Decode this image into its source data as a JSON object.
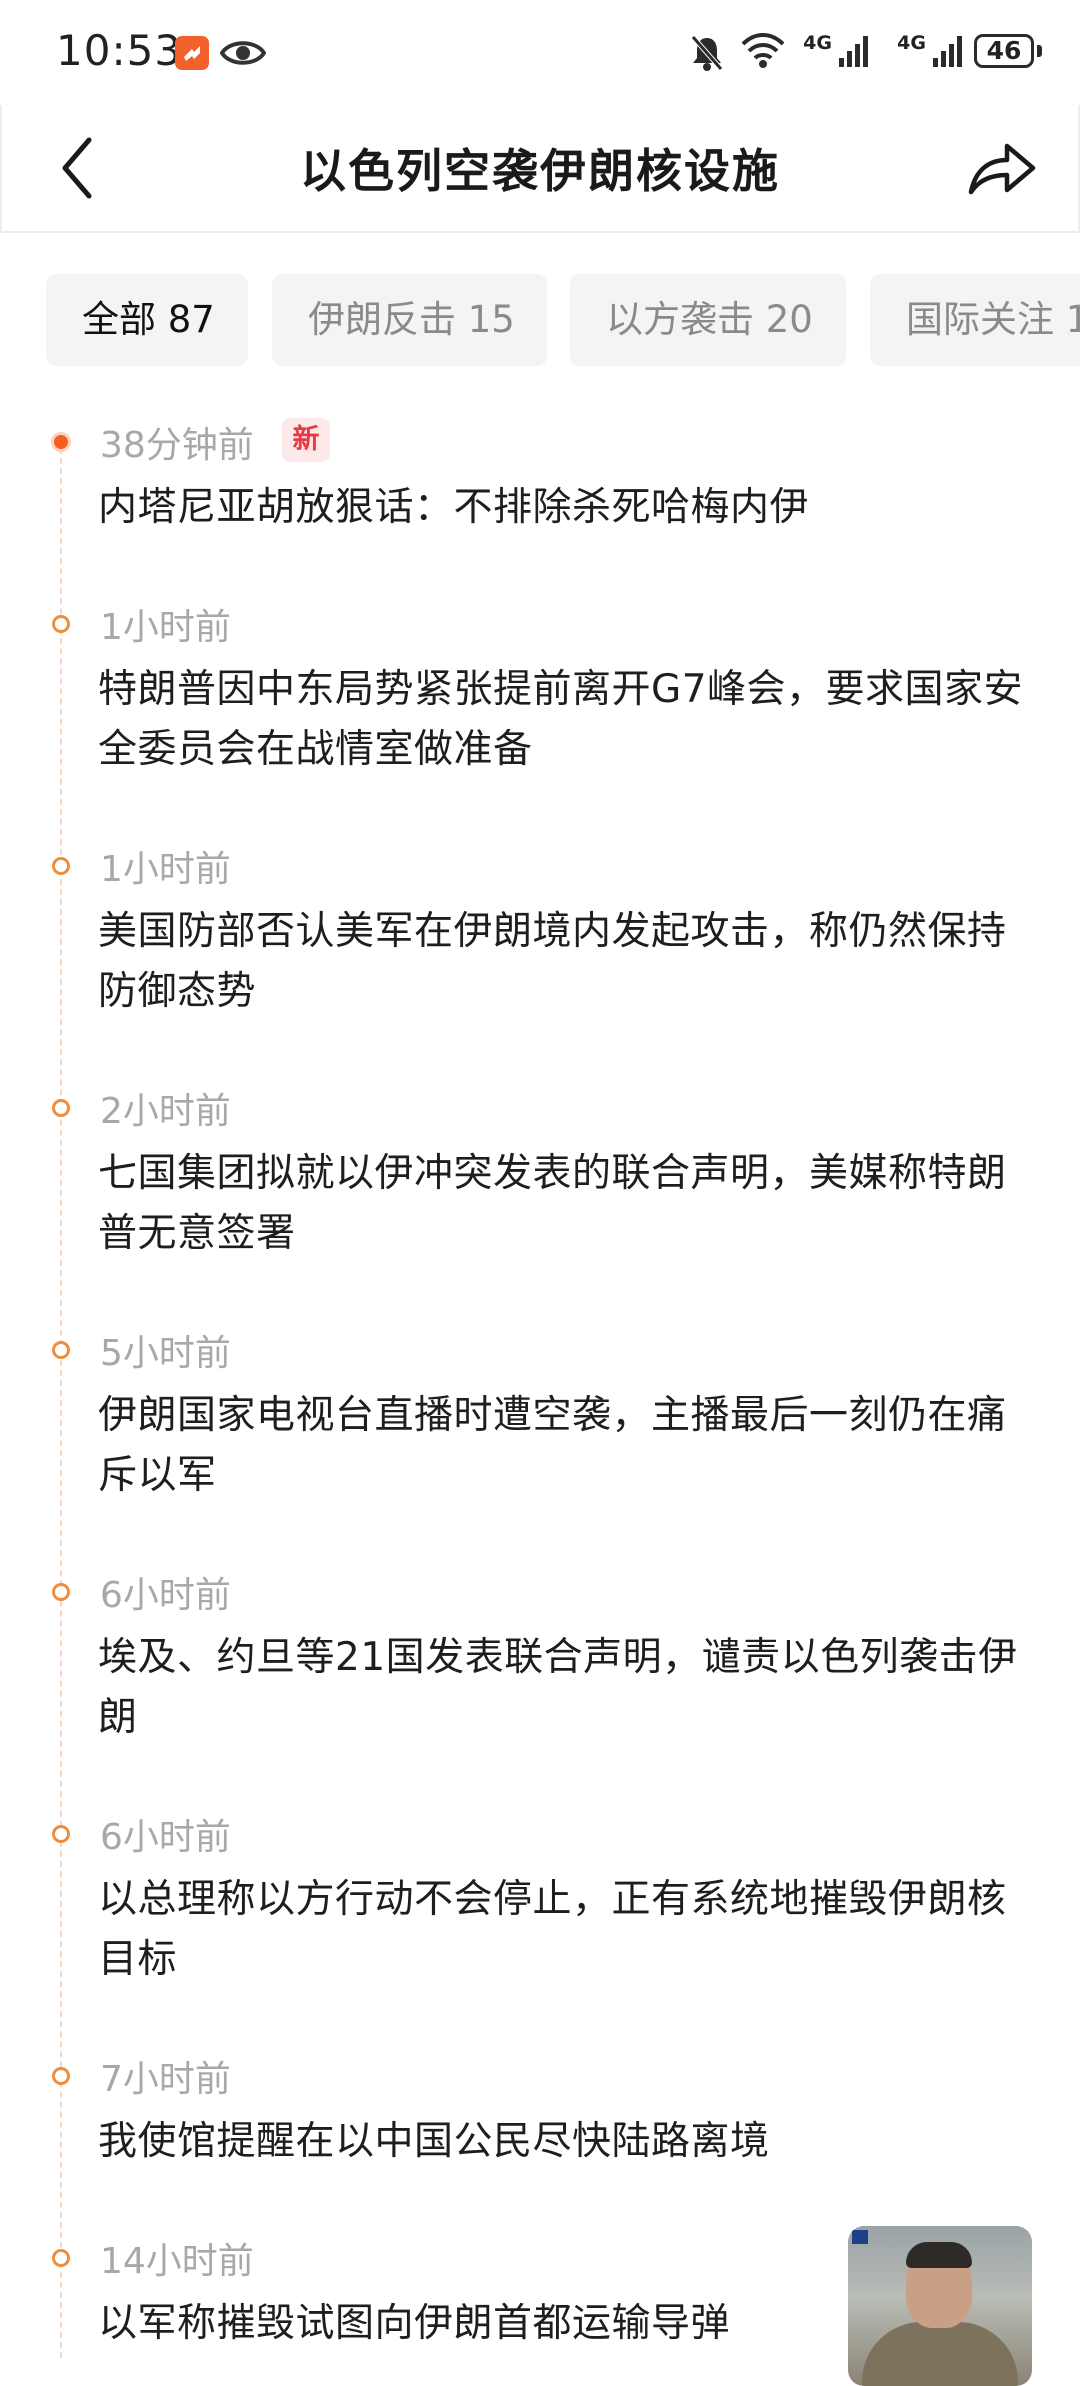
{
  "status_bar": {
    "time": "10:53",
    "net1": "4G",
    "net2": "4G",
    "battery": "46",
    "icons": [
      "app-badge-icon",
      "eye-icon",
      "bell-off-icon",
      "wifi-icon",
      "signal-icon",
      "signal-icon",
      "battery-icon"
    ]
  },
  "header": {
    "title": "以色列空袭伊朗核设施",
    "back_icon": "chevron-left-icon",
    "share_icon": "share-arrow-icon"
  },
  "tabs": [
    {
      "label": "全部 87",
      "active": true
    },
    {
      "label": "伊朗反击 15",
      "active": false
    },
    {
      "label": "以方袭击 20",
      "active": false
    },
    {
      "label": "国际关注 1",
      "active": false
    }
  ],
  "colors": {
    "accent": "#f2601f",
    "dot_ring": "#ef8d3e",
    "new_badge": "#e53946",
    "timestamp": "#a8a8a8"
  },
  "timeline": [
    {
      "time": "38分钟前",
      "badge": "新",
      "text": "内塔尼亚胡放狠话：不排除杀死哈梅内伊"
    },
    {
      "time": "1小时前",
      "text": "特朗普因中东局势紧张提前离开G7峰会，要求国家安全委员会在战情室做准备"
    },
    {
      "time": "1小时前",
      "text": "美国防部否认美军在伊朗境内发起攻击，称仍然保持防御态势"
    },
    {
      "time": "2小时前",
      "text": "七国集团拟就以伊冲突发表的联合声明，美媒称特朗普无意签署"
    },
    {
      "time": "5小时前",
      "text": "伊朗国家电视台直播时遭空袭，主播最后一刻仍在痛斥以军"
    },
    {
      "time": "6小时前",
      "text": "埃及、约旦等21国发表联合声明，谴责以色列袭击伊朗"
    },
    {
      "time": "6小时前",
      "text": "以总理称以方行动不会停止，正有系统地摧毁伊朗核目标"
    },
    {
      "time": "7小时前",
      "text": "我使馆提醒在以中国公民尽快陆路离境"
    },
    {
      "time": "14小时前",
      "text": "以军称摧毁试图向伊朗首都运输导弹"
    }
  ]
}
